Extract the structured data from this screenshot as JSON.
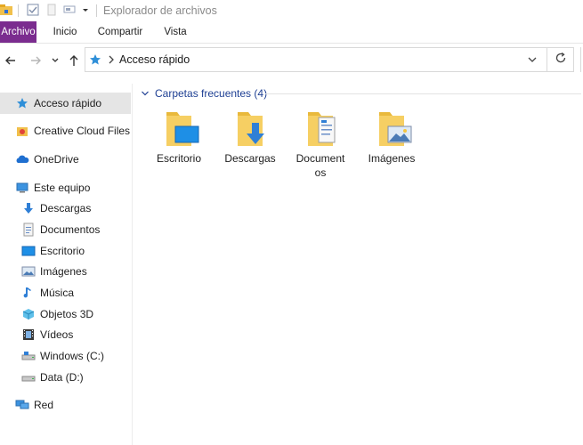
{
  "window": {
    "title": "Explorador de archivos"
  },
  "ribbon": {
    "tabs": [
      {
        "label": "Archivo",
        "active": true
      },
      {
        "label": "Inicio"
      },
      {
        "label": "Compartir"
      },
      {
        "label": "Vista"
      }
    ]
  },
  "address": {
    "location": "Acceso rápido"
  },
  "sidebar": {
    "items": [
      {
        "label": "Acceso rápido",
        "icon": "star-icon",
        "selected": true
      },
      {
        "label": "Creative Cloud Files",
        "icon": "creative-cloud-icon"
      },
      {
        "label": "OneDrive",
        "icon": "cloud-icon"
      },
      {
        "label": "Este equipo",
        "icon": "computer-icon"
      },
      {
        "label": "Descargas",
        "icon": "download-arrow-icon"
      },
      {
        "label": "Documentos",
        "icon": "document-icon"
      },
      {
        "label": "Escritorio",
        "icon": "desktop-icon"
      },
      {
        "label": "Imágenes",
        "icon": "pictures-icon"
      },
      {
        "label": "Música",
        "icon": "music-note-icon"
      },
      {
        "label": "Objetos 3D",
        "icon": "cube-icon"
      },
      {
        "label": "Vídeos",
        "icon": "film-icon"
      },
      {
        "label": "Windows (C:)",
        "icon": "drive-icon"
      },
      {
        "label": "Data (D:)",
        "icon": "drive-icon"
      },
      {
        "label": "Red",
        "icon": "network-icon"
      }
    ]
  },
  "content": {
    "group_label": "Carpetas frecuentes (4)",
    "folders": [
      {
        "label": "Escritorio",
        "icon": "desktop-folder-icon"
      },
      {
        "label": "Descargas",
        "icon": "downloads-folder-icon"
      },
      {
        "label": "Documentos",
        "icon": "documents-folder-icon"
      },
      {
        "label": "Imágenes",
        "icon": "pictures-folder-icon"
      }
    ]
  },
  "colors": {
    "accent": "#7b2c8f",
    "group_header": "#1e3f93",
    "selection": "#e5e5e5"
  }
}
